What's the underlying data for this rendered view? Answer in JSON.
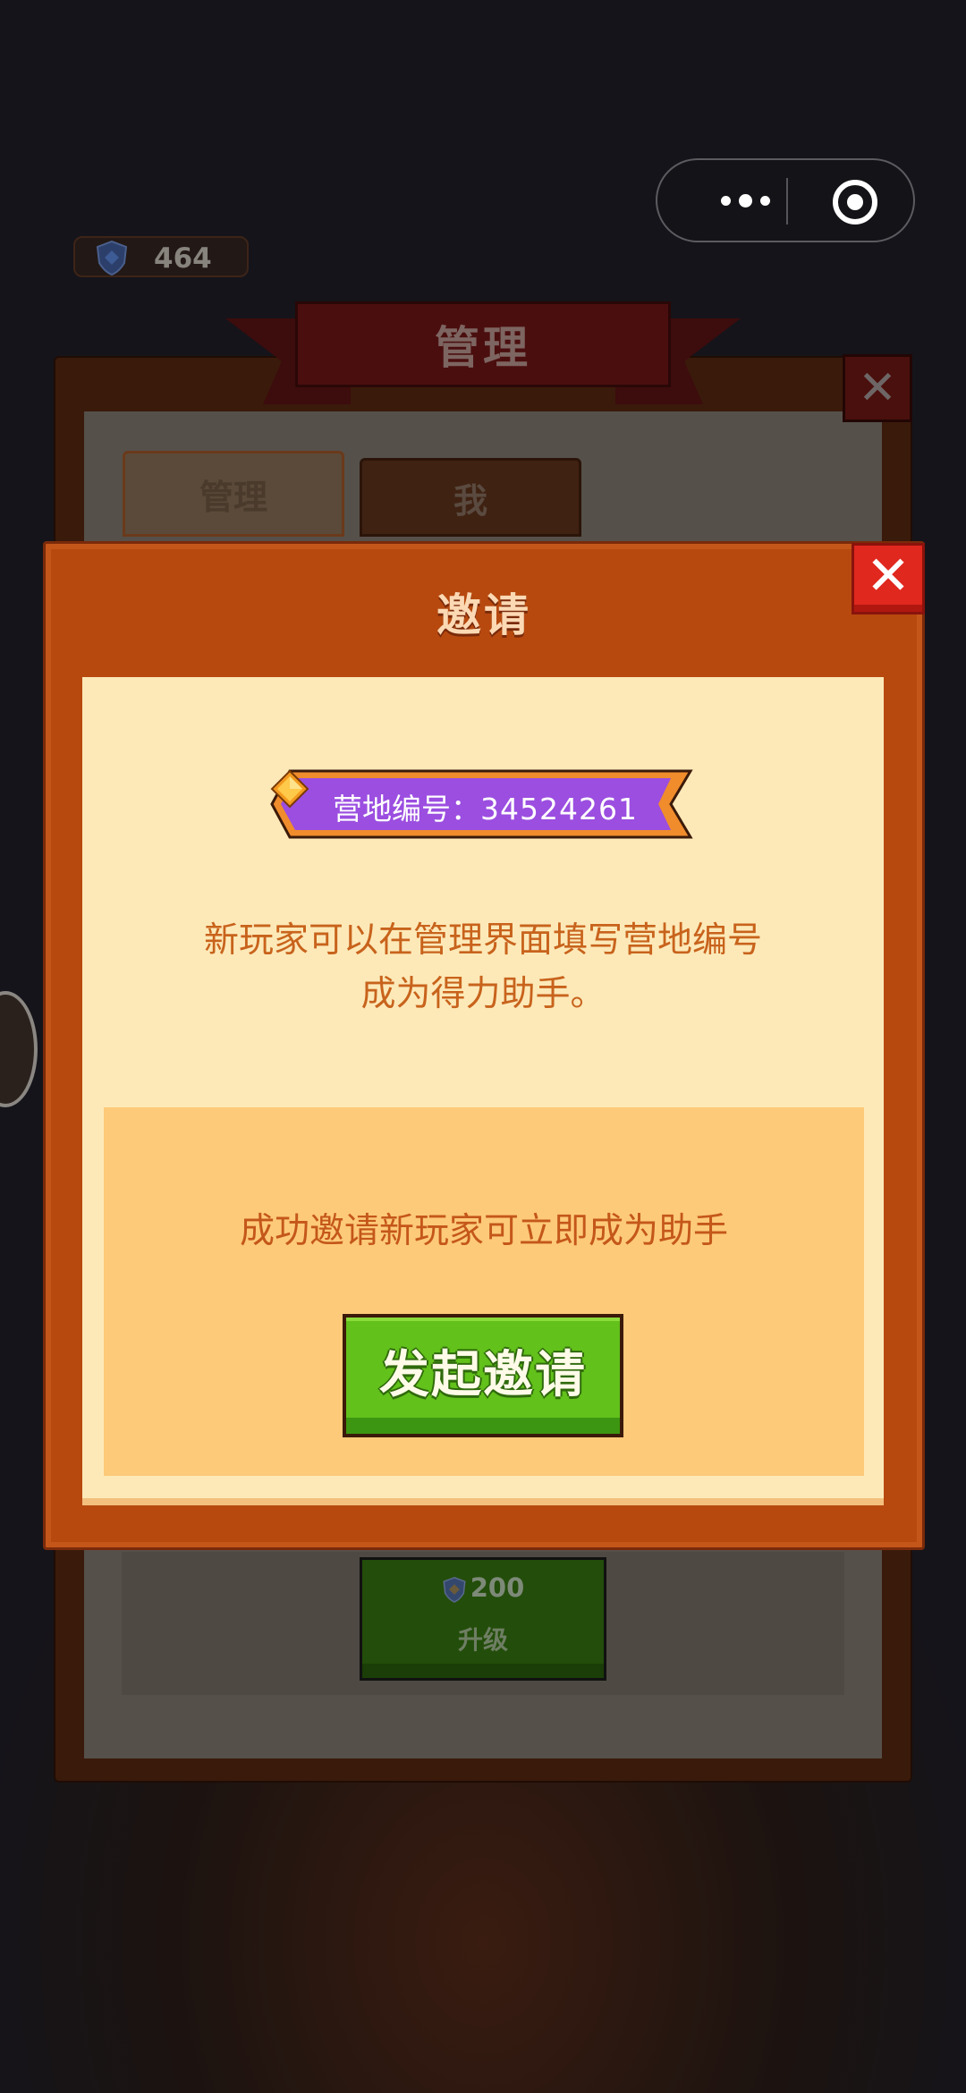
{
  "resource": {
    "value": "464",
    "icon": "shield-icon"
  },
  "management_panel": {
    "title": "管理",
    "tabs": [
      "管理",
      "我"
    ],
    "upgrade": {
      "cost": "200",
      "label": "升级"
    }
  },
  "dialog": {
    "title": "邀请",
    "camp_id_label": "营地编号：",
    "camp_id_value": "34524261",
    "description_line1": "新玩家可以在管理界面填写营地编号",
    "description_line2": "成为得力助手。",
    "reward_text": "成功邀请新玩家可立即成为助手",
    "invite_button": "发起邀请"
  },
  "colors": {
    "dialog_frame": "#b7490f",
    "dialog_body": "#fde9b8",
    "reward_box": "#fdca79",
    "text_orange": "#c8631c",
    "button_green": "#62c11a",
    "close_red": "#e0281e",
    "tag_purple": "#9b4ee0"
  }
}
